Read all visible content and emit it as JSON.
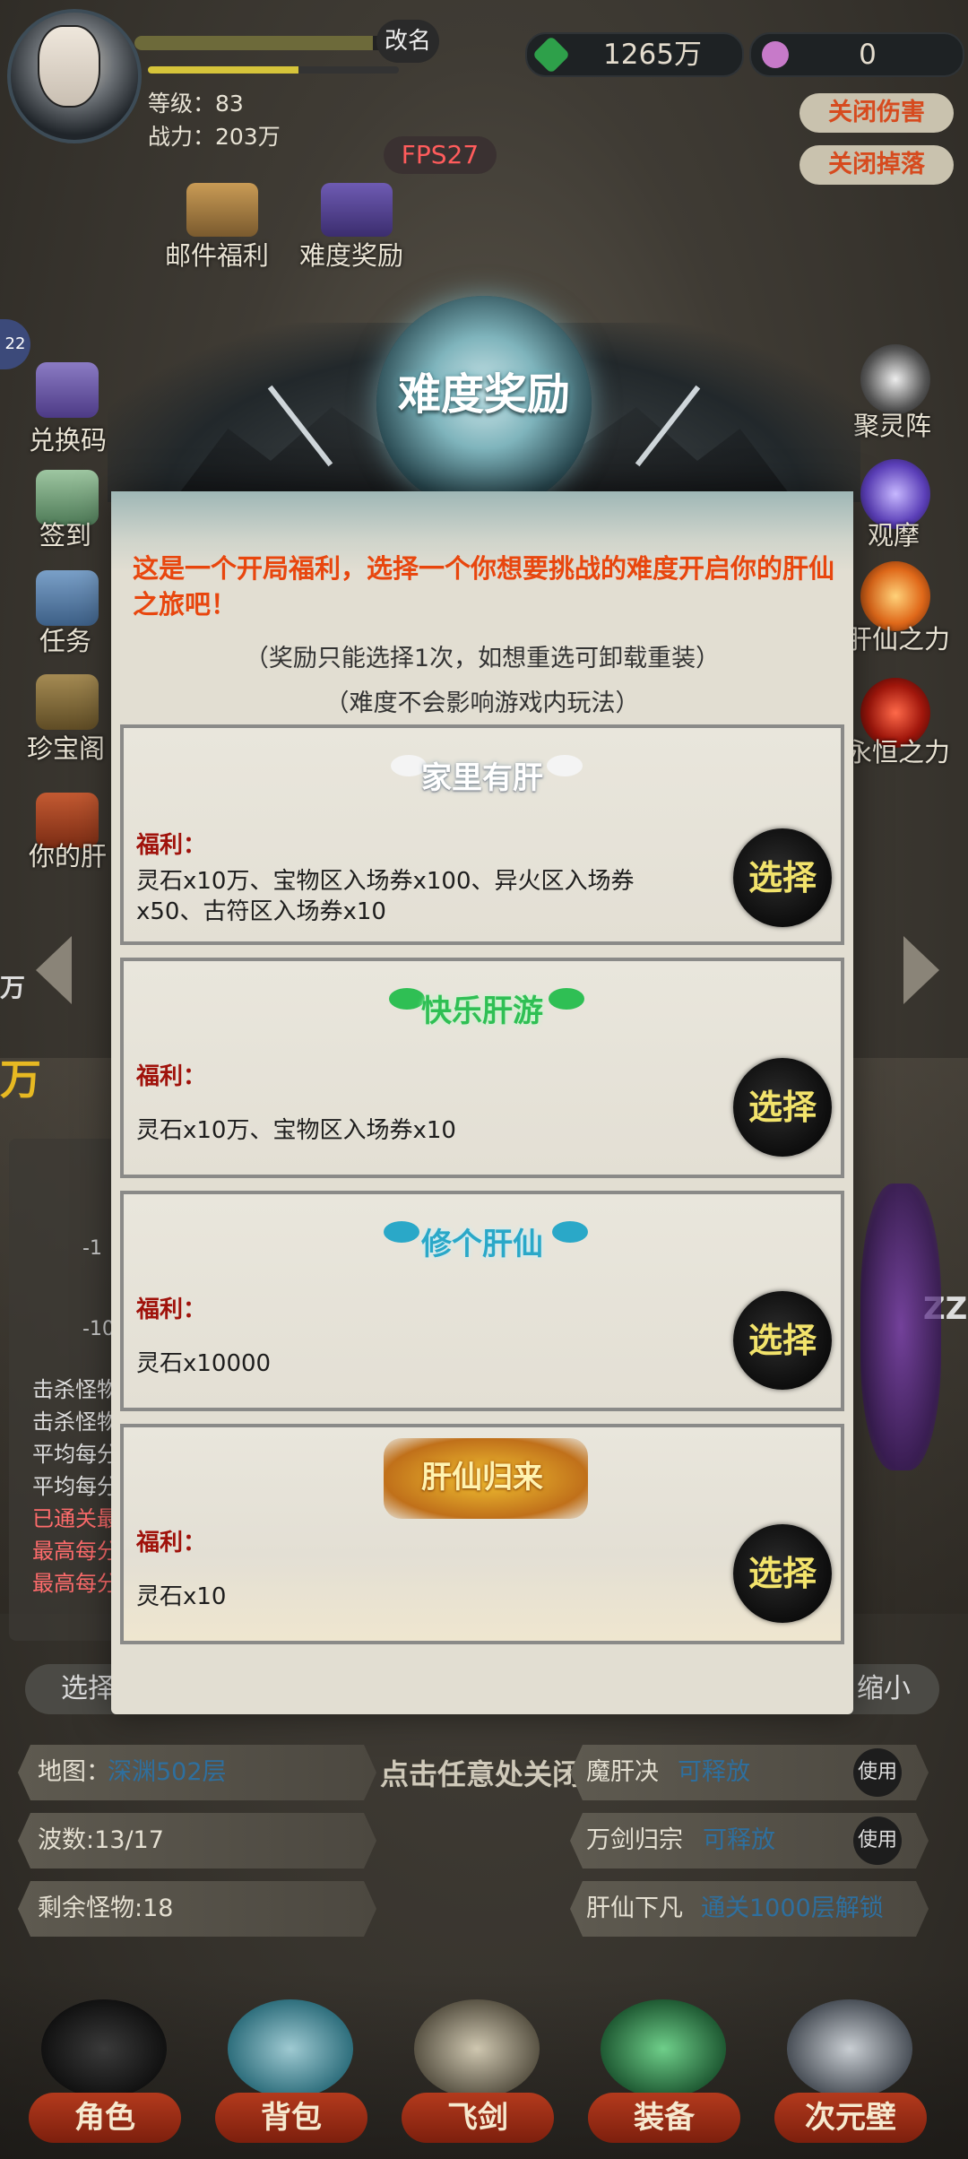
{
  "player": {
    "rename_label": "改名",
    "level": "等级：83",
    "power": "战力：203万",
    "hp_fraction": 0.9,
    "exp_fraction": 0.6
  },
  "fps": "FPS27",
  "currency": {
    "stones": "1265万",
    "gems": "0"
  },
  "toggles": {
    "damage": "关闭伤害",
    "drop": "关闭掉落"
  },
  "top_menu": {
    "mail": "邮件福利",
    "difficulty": "难度奖励"
  },
  "left_menu": [
    "兑换码",
    "签到",
    "任务",
    "珍宝阁",
    "你的肝"
  ],
  "right_menu": [
    "聚灵阵",
    "观摩",
    "肝仙之力",
    "永恒之力"
  ],
  "side_badge": "22",
  "bg_fragments": {
    "left_wan": "万",
    "left_wan_big": "万",
    "zz": "ZZ",
    "minus1": "-1",
    "minus10": "-10",
    "kill_1": "击杀怪物",
    "kill_2": "击杀怪物",
    "avg_1": "平均每分",
    "avg_2": "平均每分",
    "passed": "已通关最",
    "max_1": "最高每分",
    "max_2": "最高每分",
    "select_partial": "选择",
    "shrink": "缩小"
  },
  "modal": {
    "title": "难度奖励",
    "intro": "这是一个开局福利，选择一个你想要挑战的难度开启你的肝仙之旅吧！",
    "note1": "（奖励只能选择1次，如想重选可卸载重装）",
    "note2": "（难度不会影响游戏内玩法）",
    "benefit_label": "福利：",
    "select_label": "选择",
    "options": [
      {
        "title": "家里有肝",
        "benefit": "灵石x10万、宝物区入场券x100、异火区入场券x50、古符区入场券x10",
        "color": "#ffffff"
      },
      {
        "title": "快乐肝游",
        "benefit": "灵石x10万、宝物区入场券x10",
        "color": "#2fbf54"
      },
      {
        "title": "修个肝仙",
        "benefit": "灵石x10000",
        "color": "#2aa8c8"
      },
      {
        "title": "肝仙归来",
        "benefit": "灵石x10",
        "color": "#d9a21a"
      }
    ]
  },
  "close_hint": "点击任意处关闭",
  "stats": {
    "map_label": "地图：",
    "map_value": "深渊502层",
    "wave": "波数:13/17",
    "remaining": "剩余怪物:18"
  },
  "skills": [
    {
      "name": "魔肝决",
      "status": "可释放",
      "action": "使用"
    },
    {
      "name": "万剑归宗",
      "status": "可释放",
      "action": "使用"
    },
    {
      "name": "肝仙下凡",
      "status": "通关1000层解锁",
      "action": ""
    }
  ],
  "bottom_nav": [
    "角色",
    "背包",
    "飞剑",
    "装备",
    "次元壁"
  ],
  "colors": {
    "intro_red": "#e8460e",
    "benefit_red": "#a0120b",
    "select_yellow": "#f2e36b",
    "stat_blue": "#2e6f9e"
  }
}
